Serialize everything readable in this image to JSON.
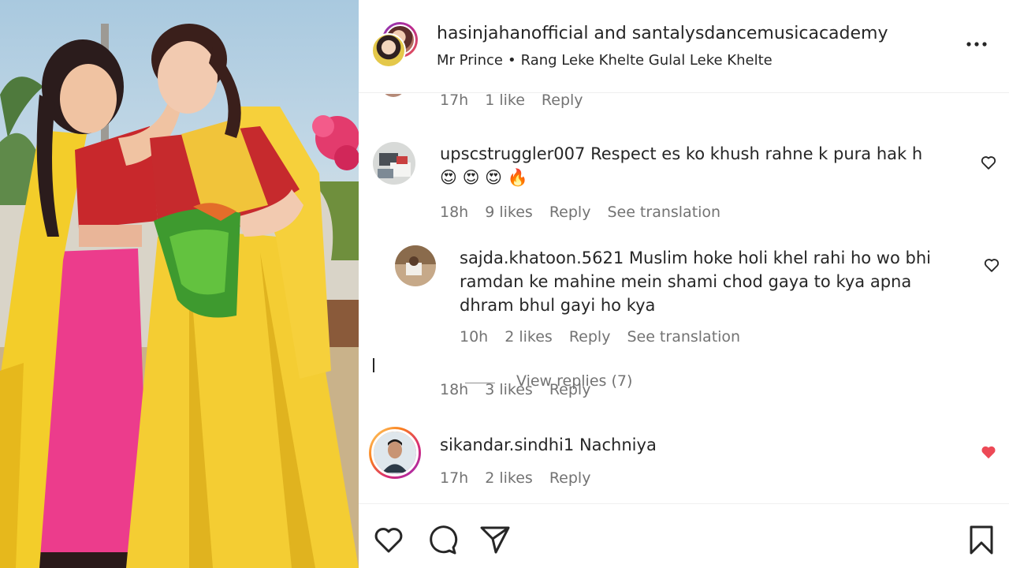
{
  "photo": {
    "alt_icon": "photo-image"
  },
  "header": {
    "usernames": "hasinjahanofficial and santalysdancemusicacademy",
    "audio_artist": "Mr Prince",
    "separator": "•",
    "audio_title": "Rang Leke Khelte Gulal Leke Khelte",
    "more_icon": "more-horizontal-icon"
  },
  "comments": [
    {
      "id": "partial-top",
      "time": "17h",
      "likes": "1 like",
      "reply": "Reply"
    },
    {
      "id": "upsc",
      "username": "upscstruggler007",
      "text": "Respect es ko khush rahne k pura hak h",
      "emojis": "😍 😍 😍 🔥",
      "time": "18h",
      "likes": "9 likes",
      "reply": "Reply",
      "translation": "See translation"
    },
    {
      "id": "sajda",
      "username": "sajda.khatoon.5621",
      "text": "Muslim hoke holi khel rahi ho wo bhi ramdan ke mahine mein shami chod gaya to kya apna dhram bhul gayi ho kya",
      "time": "10h",
      "likes": "2 likes",
      "reply": "Reply",
      "translation": "See translation"
    },
    {
      "id": "ghost",
      "view_replies": "View replies (7)",
      "time": "18h",
      "likes": "3 likes",
      "reply": "Reply"
    },
    {
      "id": "sikandar",
      "username": "sikandar.sindhi1",
      "text": "Nachniya",
      "time": "17h",
      "likes": "2 likes",
      "reply": "Reply",
      "liked": true
    }
  ],
  "actions": {
    "like_icon": "heart-icon",
    "comment_icon": "comment-icon",
    "share_icon": "send-icon",
    "save_icon": "bookmark-icon"
  },
  "colors": {
    "liked_heart": "#ed4956",
    "meta_text": "#737373",
    "text": "#262626"
  }
}
